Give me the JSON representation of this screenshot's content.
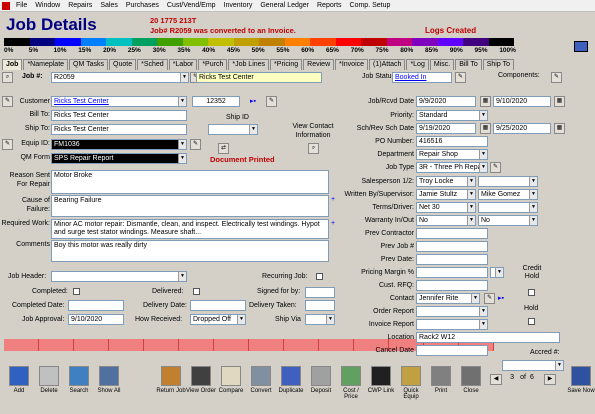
{
  "menu": [
    "File",
    "Window",
    "Repairs",
    "Sales",
    "Purchases",
    "Cust/Vend/Emp",
    "Inventory",
    "General Ledger",
    "Reports",
    "Comp. Setup"
  ],
  "header": {
    "title": "Job Details",
    "code": "20 1775 213T",
    "converted": "Job# R2059 was converted to an Invoice.",
    "logs": "Logs Created"
  },
  "progress": {
    "labels": [
      "0%",
      "5%",
      "10%",
      "15%",
      "20%",
      "25%",
      "30%",
      "35%",
      "40%",
      "45%",
      "50%",
      "55%",
      "60%",
      "65%",
      "70%",
      "75%",
      "80%",
      "85%",
      "90%",
      "95%",
      "100%"
    ],
    "colors": [
      "#000000",
      "#000080",
      "#0000ff",
      "#0080ff",
      "#00c0c0",
      "#00a060",
      "#40a000",
      "#80c000",
      "#c0c000",
      "#c0a000",
      "#c08000",
      "#ff8000",
      "#ff4000",
      "#ff0000",
      "#c00000",
      "#c00080",
      "#8000c0",
      "#6000ff",
      "#400080",
      "#000000"
    ]
  },
  "tabs": [
    "Job",
    "*Nameplate",
    "QM Tasks",
    "Quote",
    "*Sched",
    "*Labor",
    "*Purch",
    "*Job Lines",
    "*Pricing",
    "Review",
    "*Invoice",
    "(1)Attach",
    "*Log",
    "Misc.",
    "Bill To",
    "Ship To"
  ],
  "job": {
    "label": "Job #:",
    "number": "R2059",
    "name": "Ricks Test Center",
    "status_label": "Job Status:",
    "status": "Booked In",
    "components": "Components:"
  },
  "left": {
    "customer_l": "Customer",
    "customer": "Ricks Test Center",
    "custno": "12352",
    "billto_l": "Bill To:",
    "billto": "Ricks Test Center",
    "shipto_l": "Ship To:",
    "shipto": "Ricks Test Center",
    "shipid_l": "Ship ID",
    "equip_l": "Equip ID:",
    "equip": "FM1036",
    "qm_l": "QM Form",
    "qm": "SPS Repair Report",
    "view_contact": "View Contact Information",
    "doc_printed": "Document Printed",
    "reason_l": "Reason Sent For Repair",
    "reason": "Motor Broke",
    "cause_l": "Cause of Failure:",
    "cause": "Bearing Failure",
    "work_l": "Required Work:",
    "work": "Minor AC motor repair: Dismantle, clean, and inspect. Electrically test windings. Hypot and surge test stator windings. Measure shaft...",
    "comments_l": "Comments",
    "comments": "Boy this motor was really dirty",
    "jobheader_l": "Job Header:",
    "recurring_l": "Recurring Job:",
    "completed_l": "Completed:",
    "delivered_l": "Delivered:",
    "signed_l": "Signed for by:",
    "compdate_l": "Completed Date:",
    "deldate_l": "Delivery Date:",
    "deltaken_l": "Delivery Taken:",
    "approval_l": "Job Approval:",
    "approval": "9/10/2020",
    "howrec_l": "How Received:",
    "howrec": "Dropped Off",
    "shipvia_l": "Ship Via"
  },
  "right": {
    "rcvd_l": "Job/Rcvd Date",
    "rcvd1": "9/9/2020",
    "rcvd2": "9/10/2020",
    "priority_l": "Priority:",
    "priority": "Standard",
    "sched_l": "Sch/Rev Sch Date",
    "sched1": "9/19/2020",
    "sched2": "9/25/2020",
    "po_l": "PO Number:",
    "po": "416516",
    "dept_l": "Department",
    "dept": "Repair Shop",
    "type_l": "Job Type",
    "type": "3R - Three Ph Repa",
    "sales_l": "Salesperson 1/2:",
    "sales": "Troy Locke",
    "writ_l": "Written By/Supervisor:",
    "writ1": "Jamie Stultz",
    "writ2": "Mike Gomez",
    "terms_l": "Terms/Driver:",
    "terms": "Net 30",
    "warr_l": "Warranty In/Out",
    "warr1": "No",
    "warr2": "No",
    "prevc_l": "Prev Contractor",
    "prevj_l": "Prev Job #",
    "prevd_l": "Prev Date:",
    "margin_l": "Pricing Margin %",
    "credit_l": "Credit Hold",
    "rfq_l": "Cust. RFQ:",
    "contact_l": "Contact",
    "contact": "Jennifer Rite",
    "order_l": "Order Report",
    "hold_l": "Hold",
    "invrep_l": "Invoice Report",
    "loc_l": "Location",
    "loc": "Rack2 W12",
    "cancel_l": "Cancel Date",
    "accred_l": "Accred #:",
    "nav_pos": "3",
    "nav_of": "of",
    "nav_total": "6"
  },
  "toolbar": [
    "Add",
    "Delete",
    "Search",
    "Show All",
    "Return Job",
    "View Order",
    "Compare",
    "Convert",
    "Duplicate",
    "Deposit",
    "Cost / Price",
    "CWP Link",
    "Quick Equip",
    "Print",
    "Close",
    "Save Now"
  ]
}
